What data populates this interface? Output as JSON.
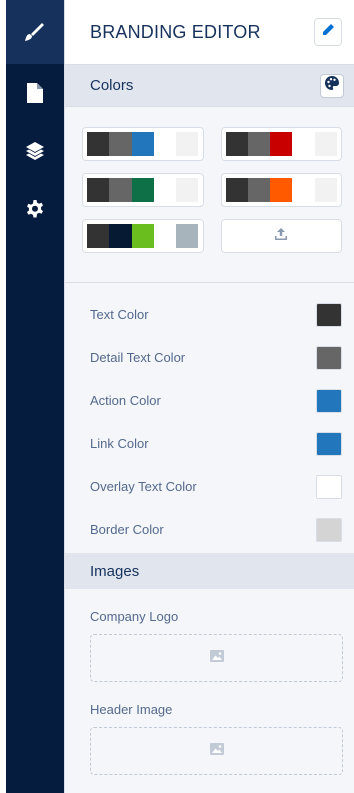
{
  "sidebar": {
    "items": [
      {
        "icon": "brush-icon",
        "active": true
      },
      {
        "icon": "page-icon",
        "active": false
      },
      {
        "icon": "layers-icon",
        "active": false
      },
      {
        "icon": "gear-icon",
        "active": false
      }
    ]
  },
  "header": {
    "title": "BRANDING EDITOR",
    "edit_icon": "pencil-icon"
  },
  "colors_section": {
    "title": "Colors",
    "theme_icon": "palette-icon",
    "palettes": [
      [
        "#333333",
        "#666666",
        "#2176bc",
        "#ffffff",
        "#f2f2f2"
      ],
      [
        "#333333",
        "#666666",
        "#c90000",
        "#ffffff",
        "#f2f2f2"
      ],
      [
        "#333333",
        "#666666",
        "#0d7046",
        "#ffffff",
        "#f2f2f2"
      ],
      [
        "#333333",
        "#666666",
        "#ff5a00",
        "#ffffff",
        "#f2f2f2"
      ],
      [
        "#333333",
        "#061a33",
        "#6abf1e",
        "#ffffff",
        "#a8b4bc"
      ]
    ],
    "upload_icon": "upload-icon",
    "items": [
      {
        "label": "Text Color",
        "color": "#333333"
      },
      {
        "label": "Detail Text Color",
        "color": "#666666"
      },
      {
        "label": "Action Color",
        "color": "#2176bc"
      },
      {
        "label": "Link Color",
        "color": "#2176bc"
      },
      {
        "label": "Overlay Text Color",
        "color": "#ffffff"
      },
      {
        "label": "Border Color",
        "color": "#d4d4d4"
      }
    ]
  },
  "images_section": {
    "title": "Images",
    "items": [
      {
        "label": "Company Logo",
        "icon": "image-icon"
      },
      {
        "label": "Header Image",
        "icon": "image-icon"
      }
    ]
  }
}
